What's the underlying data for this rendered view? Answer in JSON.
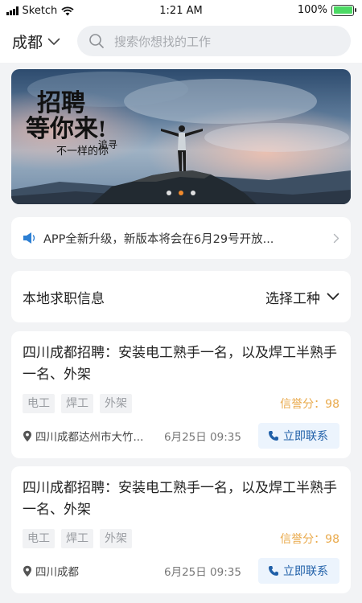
{
  "status_bar": {
    "carrier": "Sketch",
    "time": "1:21 AM",
    "battery": "100%",
    "battery_level": 1.0
  },
  "header": {
    "city": "成都",
    "search_placeholder": "搜索你想找的工作"
  },
  "banner": {
    "headline_1": "招聘",
    "headline_2": "等你来!",
    "tagline_1": "追寻",
    "tagline_2": "不一样的你",
    "indicator_count": 3,
    "active_indicator": 1
  },
  "notice": {
    "text": "APP全新升级，新版本将会在6月29号开放..."
  },
  "section": {
    "title": "本地求职信息",
    "filter_label": "选择工种"
  },
  "jobs": [
    {
      "title": "四川成都招聘：安装电工熟手一名，以及焊工半熟手一名、外架",
      "tags": [
        "电工",
        "焊工",
        "外架"
      ],
      "credit": "信誉分：98",
      "location": "四川成都达州市大竹...",
      "date": "6月25日 09:35",
      "contact_label": "立即联系"
    },
    {
      "title": "四川成都招聘：安装电工熟手一名，以及焊工半熟手一名、外架",
      "tags": [
        "电工",
        "焊工",
        "外架"
      ],
      "credit": "信誉分：98",
      "location": "四川成都",
      "date": "6月25日 09:35",
      "contact_label": "立即联系"
    }
  ],
  "colors": {
    "accent_blue": "#1f5fa8",
    "credit_orange": "#e9a94a",
    "background": "#f2f3f5"
  }
}
